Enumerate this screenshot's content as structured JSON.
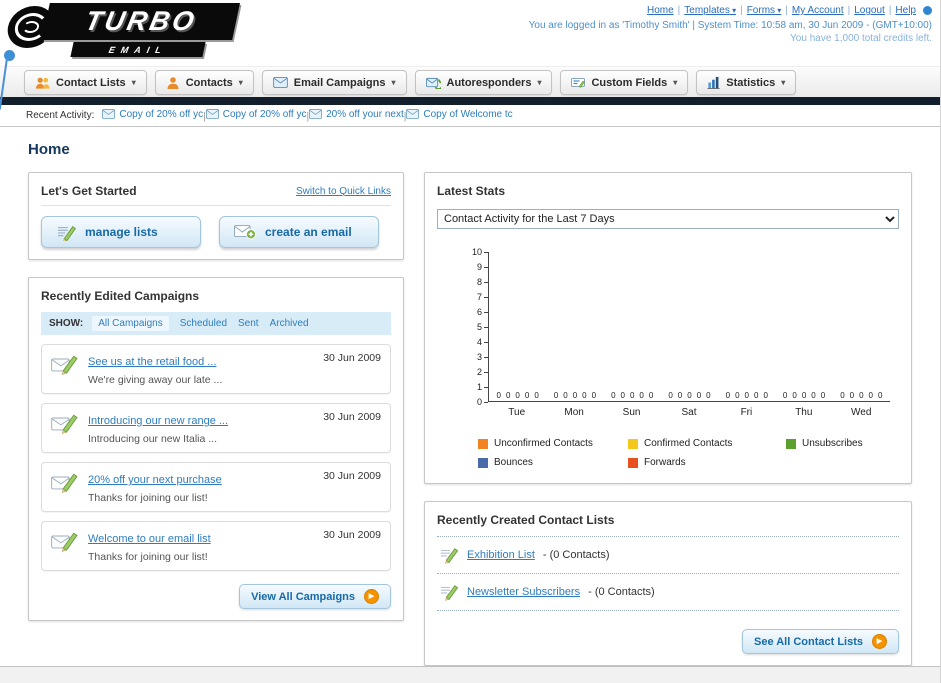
{
  "header": {
    "logo": {
      "title": "TURBO",
      "subtitle": "EMAIL"
    },
    "nav_links": [
      {
        "label": "Home",
        "caret": false
      },
      {
        "label": "Templates",
        "caret": true
      },
      {
        "label": "Forms",
        "caret": true
      },
      {
        "label": "My Account",
        "caret": false
      },
      {
        "label": "Logout",
        "caret": false
      },
      {
        "label": "Help",
        "caret": false
      }
    ],
    "login_info": "You are logged in as 'Timothy Smith' | System Time: 10:58 am, 30 Jun 2009 - (GMT+10:00)",
    "credits_info": "You have 1,000 total credits left."
  },
  "main_nav": {
    "items": [
      {
        "label": "Contact Lists",
        "icon": "contact-lists-icon"
      },
      {
        "label": "Contacts",
        "icon": "contacts-icon"
      },
      {
        "label": "Email Campaigns",
        "icon": "email-campaigns-icon"
      },
      {
        "label": "Autoresponders",
        "icon": "autoresponders-icon"
      },
      {
        "label": "Custom Fields",
        "icon": "custom-fields-icon"
      },
      {
        "label": "Statistics",
        "icon": "statistics-icon"
      }
    ]
  },
  "recent_activity": {
    "label": "Recent Activity:",
    "items": [
      {
        "label": "Copy of 20% off yc"
      },
      {
        "label": "Copy of 20% off yc"
      },
      {
        "label": "20% off your next"
      },
      {
        "label": "Copy of Welcome tc"
      }
    ]
  },
  "page_title": "Home",
  "get_started": {
    "title": "Let's Get Started",
    "switch_link": "Switch to Quick Links",
    "buttons": [
      {
        "label": "manage lists",
        "icon": "pencil-list-icon"
      },
      {
        "label": "create an email",
        "icon": "envelope-plus-icon"
      }
    ]
  },
  "campaigns": {
    "title": "Recently Edited Campaigns",
    "show_label": "SHOW:",
    "tabs": [
      {
        "label": "All Campaigns",
        "selected": true
      },
      {
        "label": "Scheduled",
        "selected": false
      },
      {
        "label": "Sent",
        "selected": false
      },
      {
        "label": "Archived",
        "selected": false
      }
    ],
    "items": [
      {
        "title": "See us at the retail food ...",
        "subtitle": "We're giving away our late ...",
        "date": "30 Jun 2009"
      },
      {
        "title": "Introducing our new range ...",
        "subtitle": "Introducing our new Italia ...",
        "date": "30 Jun 2009"
      },
      {
        "title": "20% off your next purchase",
        "subtitle": "Thanks for joining our list!",
        "date": "30 Jun 2009"
      },
      {
        "title": "Welcome to our email list",
        "subtitle": "Thanks for joining our list!",
        "date": "30 Jun 2009"
      }
    ],
    "view_all_label": "View All Campaigns"
  },
  "latest_stats": {
    "title": "Latest Stats",
    "dropdown_value": "Contact Activity for the Last 7 Days"
  },
  "chart_data": {
    "type": "bar",
    "title": "Contact Activity for the Last 7 Days",
    "categories": [
      "Tue",
      "Mon",
      "Sun",
      "Sat",
      "Fri",
      "Thu",
      "Wed"
    ],
    "series": [
      {
        "name": "Unconfirmed Contacts",
        "color": "#f28222",
        "values": [
          0,
          0,
          0,
          0,
          0,
          0,
          0
        ]
      },
      {
        "name": "Confirmed Contacts",
        "color": "#f5c71a",
        "values": [
          0,
          0,
          0,
          0,
          0,
          0,
          0
        ]
      },
      {
        "name": "Unsubscribes",
        "color": "#5ba02c",
        "values": [
          0,
          0,
          0,
          0,
          0,
          0,
          0
        ]
      },
      {
        "name": "Bounces",
        "color": "#4a69a8",
        "values": [
          0,
          0,
          0,
          0,
          0,
          0,
          0
        ]
      },
      {
        "name": "Forwards",
        "color": "#e8501e",
        "values": [
          0,
          0,
          0,
          0,
          0,
          0,
          0
        ]
      }
    ],
    "ylim": [
      0,
      10
    ],
    "grid": false,
    "legend_position": "bottom"
  },
  "contact_lists": {
    "title": "Recently Created Contact Lists",
    "items": [
      {
        "name": "Exhibition List",
        "suffix": "- (0 Contacts)"
      },
      {
        "name": "Newsletter Subscribers",
        "suffix": "- (0 Contacts)"
      }
    ],
    "see_all_label": "See All Contact Lists"
  }
}
